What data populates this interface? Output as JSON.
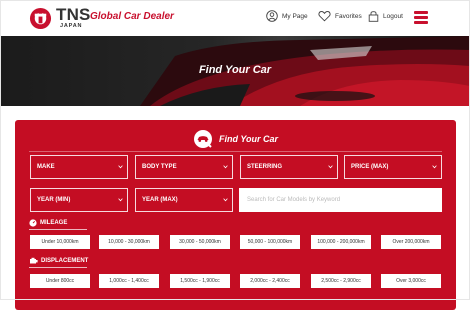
{
  "header": {
    "logo_text": "TNS",
    "logo_sub": "JAPAN",
    "tagline": "Global Car Dealer",
    "nav": [
      {
        "label": "My Page",
        "icon": "user-icon"
      },
      {
        "label": "Favorites",
        "icon": "heart-icon"
      },
      {
        "label": "Logout",
        "icon": "lock-icon"
      }
    ],
    "menu_icon": "hamburger-icon",
    "accent_color": "#c8102e"
  },
  "hero": {
    "title": "Find Your Car"
  },
  "search": {
    "title": "Find Your Car",
    "panel_color": "#c40d23",
    "selects": [
      {
        "label": "MAKE"
      },
      {
        "label": "BODY TYPE"
      },
      {
        "label": "STEERRING"
      },
      {
        "label": "PRICE (MAX)"
      },
      {
        "label": "YEAR (MIN)"
      },
      {
        "label": "YEAR (MAX)"
      }
    ],
    "keyword_placeholder": "Search for Car Models by Keyword",
    "mileage": {
      "label": "MILEAGE",
      "options": [
        "Under 10,000km",
        "10,000 - 30,000km",
        "30,000 - 50,000km",
        "50,000 - 100,000km",
        "100,000 - 200,000km",
        "Over 200,000km"
      ]
    },
    "displacement": {
      "label": "DISPLACEMENT",
      "options": [
        "Under 800cc",
        "1,000cc - 1,400cc",
        "1,500cc - 1,900cc",
        "2,000cc - 2,400cc",
        "2,500cc - 2,900cc",
        "Over 3,000cc"
      ]
    }
  }
}
